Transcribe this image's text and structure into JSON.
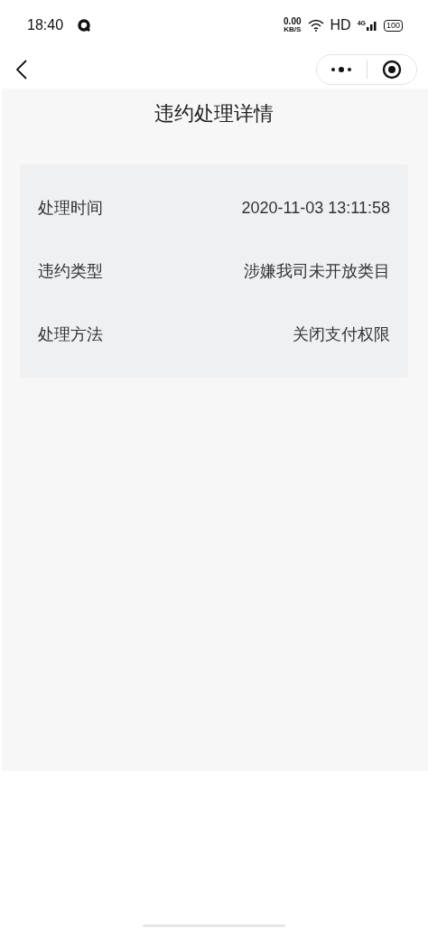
{
  "status_bar": {
    "time": "18:40",
    "speed": "0.00",
    "speed_unit": "KB/S",
    "hd": "HD",
    "network": "4G",
    "battery": "100"
  },
  "page": {
    "title": "违约处理详情",
    "rows": [
      {
        "label": "处理时间",
        "value": "2020-11-03 13:11:58"
      },
      {
        "label": "违约类型",
        "value": "涉嫌我司未开放类目"
      },
      {
        "label": "处理方法",
        "value": "关闭支付权限"
      }
    ]
  }
}
